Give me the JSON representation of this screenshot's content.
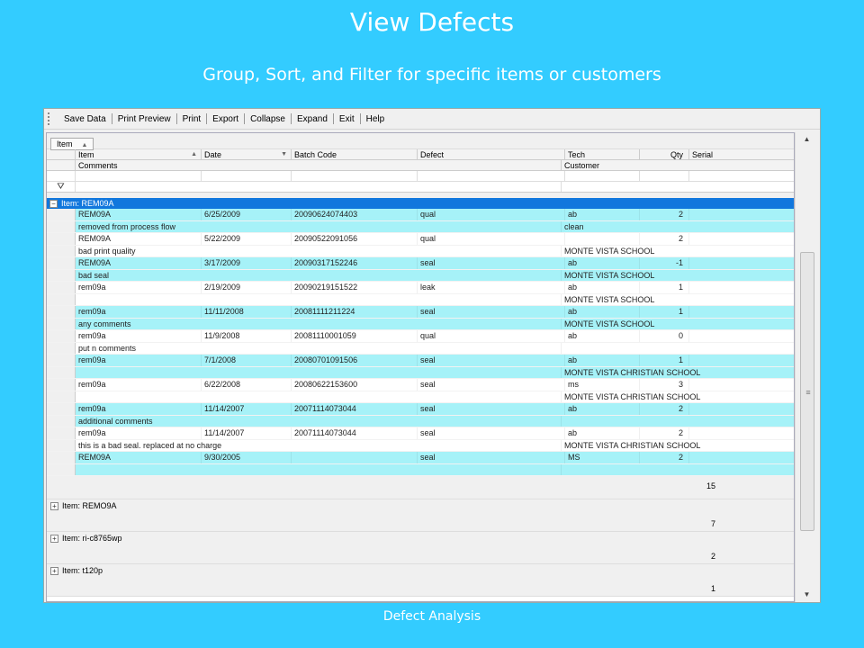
{
  "slide": {
    "title": "View Defects",
    "subtitle": "Group, Sort, and Filter for specific items or customers",
    "caption": "Defect Analysis"
  },
  "toolbar": {
    "items": [
      "Save Data",
      "Print Preview",
      "Print",
      "Export",
      "Collapse",
      "Expand",
      "Exit",
      "Help"
    ]
  },
  "group_panel": {
    "chip": "Item"
  },
  "columns": {
    "item": "Item",
    "date": "Date",
    "batch": "Batch Code",
    "defect": "Defect",
    "tech": "Tech",
    "qty": "Qty",
    "serial": "Serial",
    "comments": "Comments",
    "customer": "Customer"
  },
  "groups": [
    {
      "label": "Item:  REM09A",
      "expanded": true,
      "sum": "15"
    },
    {
      "label": "Item:  REMO9A",
      "expanded": false,
      "sum": "7"
    },
    {
      "label": "Item:  ri-c8765wp",
      "expanded": false,
      "sum": "2"
    },
    {
      "label": "Item:  t120p",
      "expanded": false,
      "sum": "1"
    }
  ],
  "toggle_symbols": {
    "expanded": "−",
    "collapsed": "+"
  },
  "rows": [
    {
      "item": "REM09A",
      "date": "6/25/2009",
      "batch": "20090624074403",
      "defect": "qual",
      "tech": "ab",
      "qty": "2",
      "serial": "",
      "comments": "removed from process flow",
      "customer": "clean",
      "color": "cyan"
    },
    {
      "item": "REM09A",
      "date": "5/22/2009",
      "batch": "20090522091056",
      "defect": "qual",
      "tech": "",
      "qty": "2",
      "serial": "",
      "comments": "bad print quality",
      "customer": "MONTE VISTA SCHOOL",
      "color": "white"
    },
    {
      "item": "REM09A",
      "date": "3/17/2009",
      "batch": "20090317152246",
      "defect": "seal",
      "tech": "ab",
      "qty": "-1",
      "serial": "",
      "comments": "bad seal",
      "customer": "MONTE VISTA SCHOOL",
      "color": "cyan"
    },
    {
      "item": "rem09a",
      "date": "2/19/2009",
      "batch": "20090219151522",
      "defect": "leak",
      "tech": "ab",
      "qty": "1",
      "serial": "",
      "comments": "",
      "customer": "MONTE VISTA SCHOOL",
      "color": "white"
    },
    {
      "item": "rem09a",
      "date": "11/11/2008",
      "batch": "20081111211224",
      "defect": "seal",
      "tech": "ab",
      "qty": "1",
      "serial": "",
      "comments": "any comments",
      "customer": "MONTE VISTA SCHOOL",
      "color": "cyan"
    },
    {
      "item": "rem09a",
      "date": "11/9/2008",
      "batch": "20081110001059",
      "defect": "qual",
      "tech": "ab",
      "qty": "0",
      "serial": "",
      "comments": "put n comments",
      "customer": "",
      "color": "white"
    },
    {
      "item": "rem09a",
      "date": "7/1/2008",
      "batch": "20080701091506",
      "defect": "seal",
      "tech": "ab",
      "qty": "1",
      "serial": "",
      "comments": "",
      "customer": "MONTE VISTA CHRISTIAN SCHOOL",
      "color": "cyan"
    },
    {
      "item": "rem09a",
      "date": "6/22/2008",
      "batch": "20080622153600",
      "defect": "seal",
      "tech": "ms",
      "qty": "3",
      "serial": "",
      "comments": "",
      "customer": "MONTE VISTA CHRISTIAN SCHOOL",
      "color": "white"
    },
    {
      "item": "rem09a",
      "date": "11/14/2007",
      "batch": "20071114073044",
      "defect": "seal",
      "tech": "ab",
      "qty": "2",
      "serial": "",
      "comments": "additional comments",
      "customer": "",
      "color": "cyan"
    },
    {
      "item": "rem09a",
      "date": "11/14/2007",
      "batch": "20071114073044",
      "defect": "seal",
      "tech": "ab",
      "qty": "2",
      "serial": "",
      "comments": "this is a bad seal.  replaced at no charge",
      "customer": "MONTE VISTA CHRISTIAN SCHOOL",
      "color": "white"
    },
    {
      "item": "REM09A",
      "date": "9/30/2005",
      "batch": "",
      "defect": "seal",
      "tech": "MS",
      "qty": "2",
      "serial": "",
      "comments": "",
      "customer": "",
      "color": "cyan"
    }
  ]
}
